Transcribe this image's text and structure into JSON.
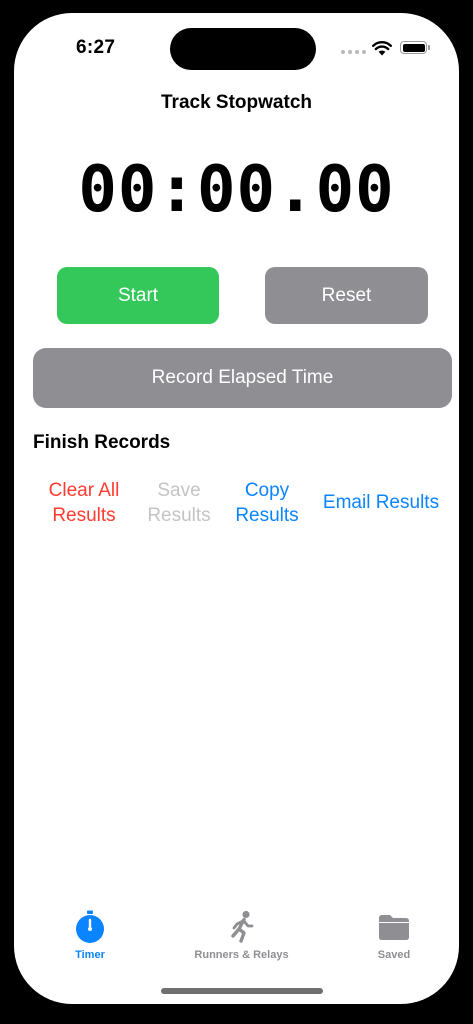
{
  "status_bar": {
    "time": "6:27"
  },
  "page": {
    "title": "Track Stopwatch"
  },
  "timer": {
    "display": "00:00.00"
  },
  "controls": {
    "start_label": "Start",
    "reset_label": "Reset",
    "record_label": "Record Elapsed Time"
  },
  "records": {
    "title": "Finish Records",
    "actions": {
      "clear_line1": "Clear All",
      "clear_line2": "Results",
      "save_line1": "Save",
      "save_line2": "Results",
      "copy_line1": "Copy",
      "copy_line2": "Results",
      "email": "Email Results"
    }
  },
  "tabbar": {
    "tabs": [
      {
        "label": "Timer",
        "icon": "stopwatch-icon",
        "active": true
      },
      {
        "label": "Runners & Relays",
        "icon": "runner-icon",
        "active": false
      },
      {
        "label": "Saved",
        "icon": "folder-icon",
        "active": false
      }
    ]
  },
  "colors": {
    "start": "#34c759",
    "neutral_button": "#8e8e93",
    "destructive": "#ff3b30",
    "disabled": "#c4c4c6",
    "accent": "#0a84ff"
  }
}
